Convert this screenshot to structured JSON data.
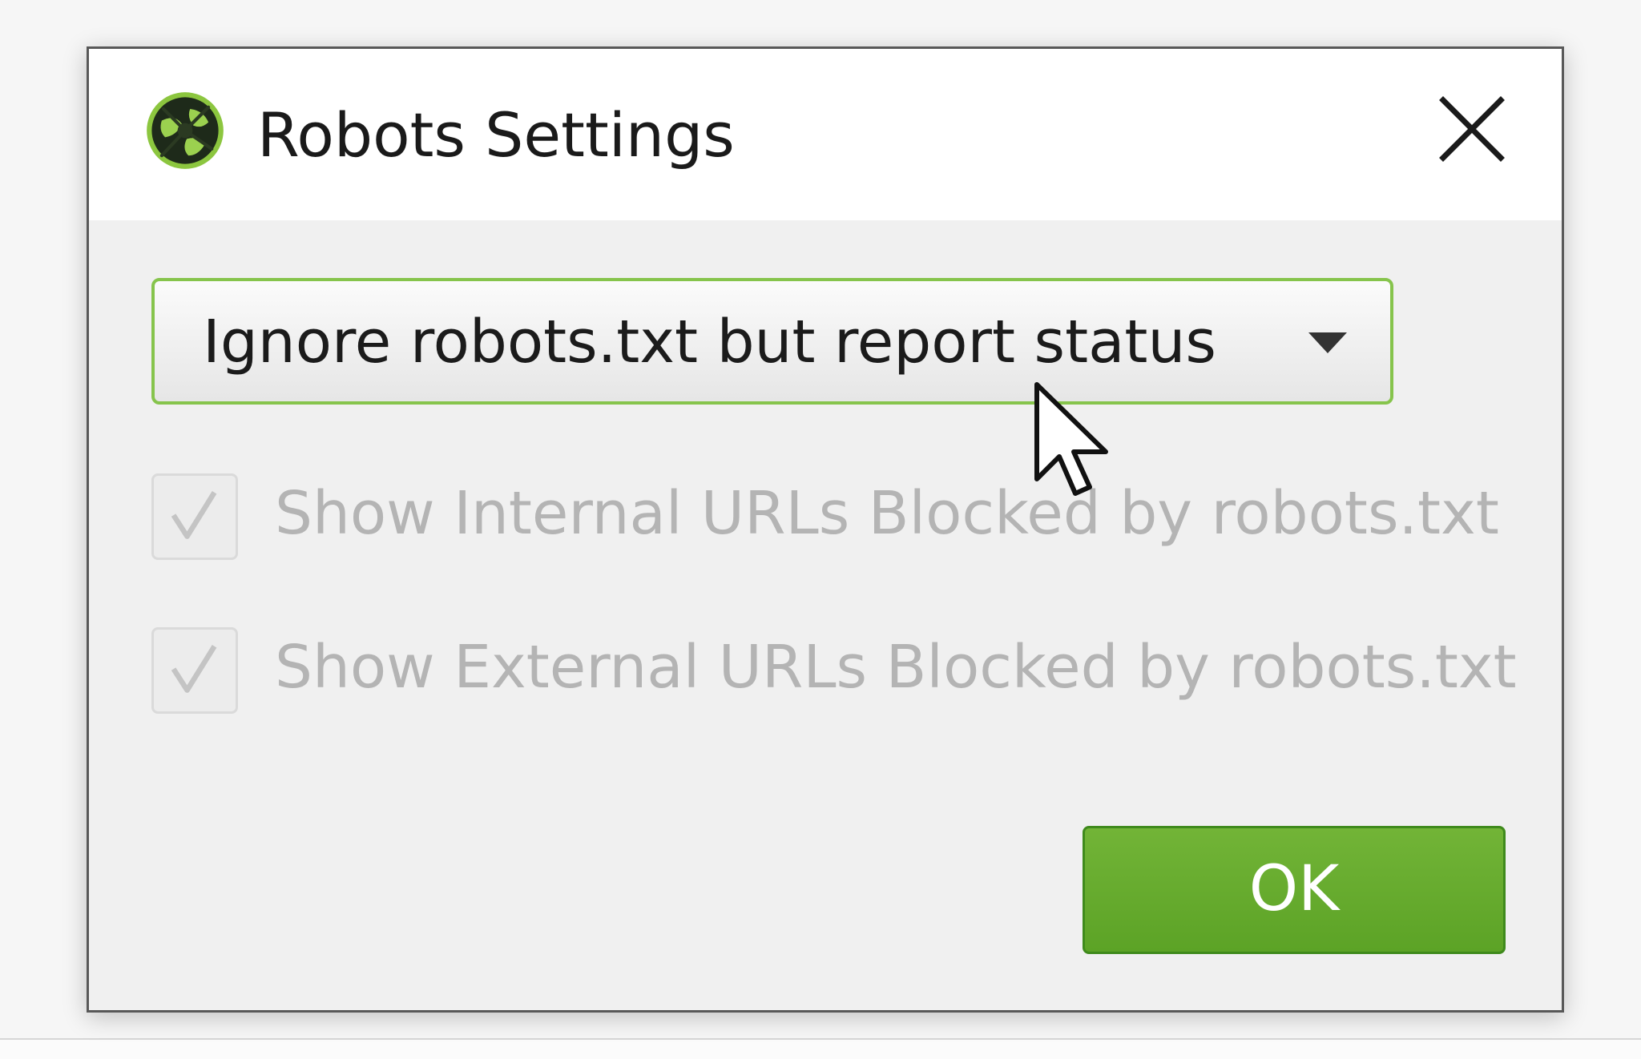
{
  "dialog": {
    "title": "Robots Settings",
    "icon": "spider-globe-icon",
    "close_icon": "close-icon"
  },
  "robots_mode": {
    "selected": "Ignore robots.txt but report status",
    "icon": "chevron-down-icon"
  },
  "options": [
    {
      "label": "Show Internal URLs Blocked by robots.txt",
      "checked": true,
      "enabled": false
    },
    {
      "label": "Show External URLs Blocked by robots.txt",
      "checked": true,
      "enabled": false
    }
  ],
  "buttons": {
    "ok_label": "OK"
  },
  "colors": {
    "accent_green": "#6aae30",
    "focus_border": "#86c44c",
    "disabled_text": "#b4b4b4"
  }
}
